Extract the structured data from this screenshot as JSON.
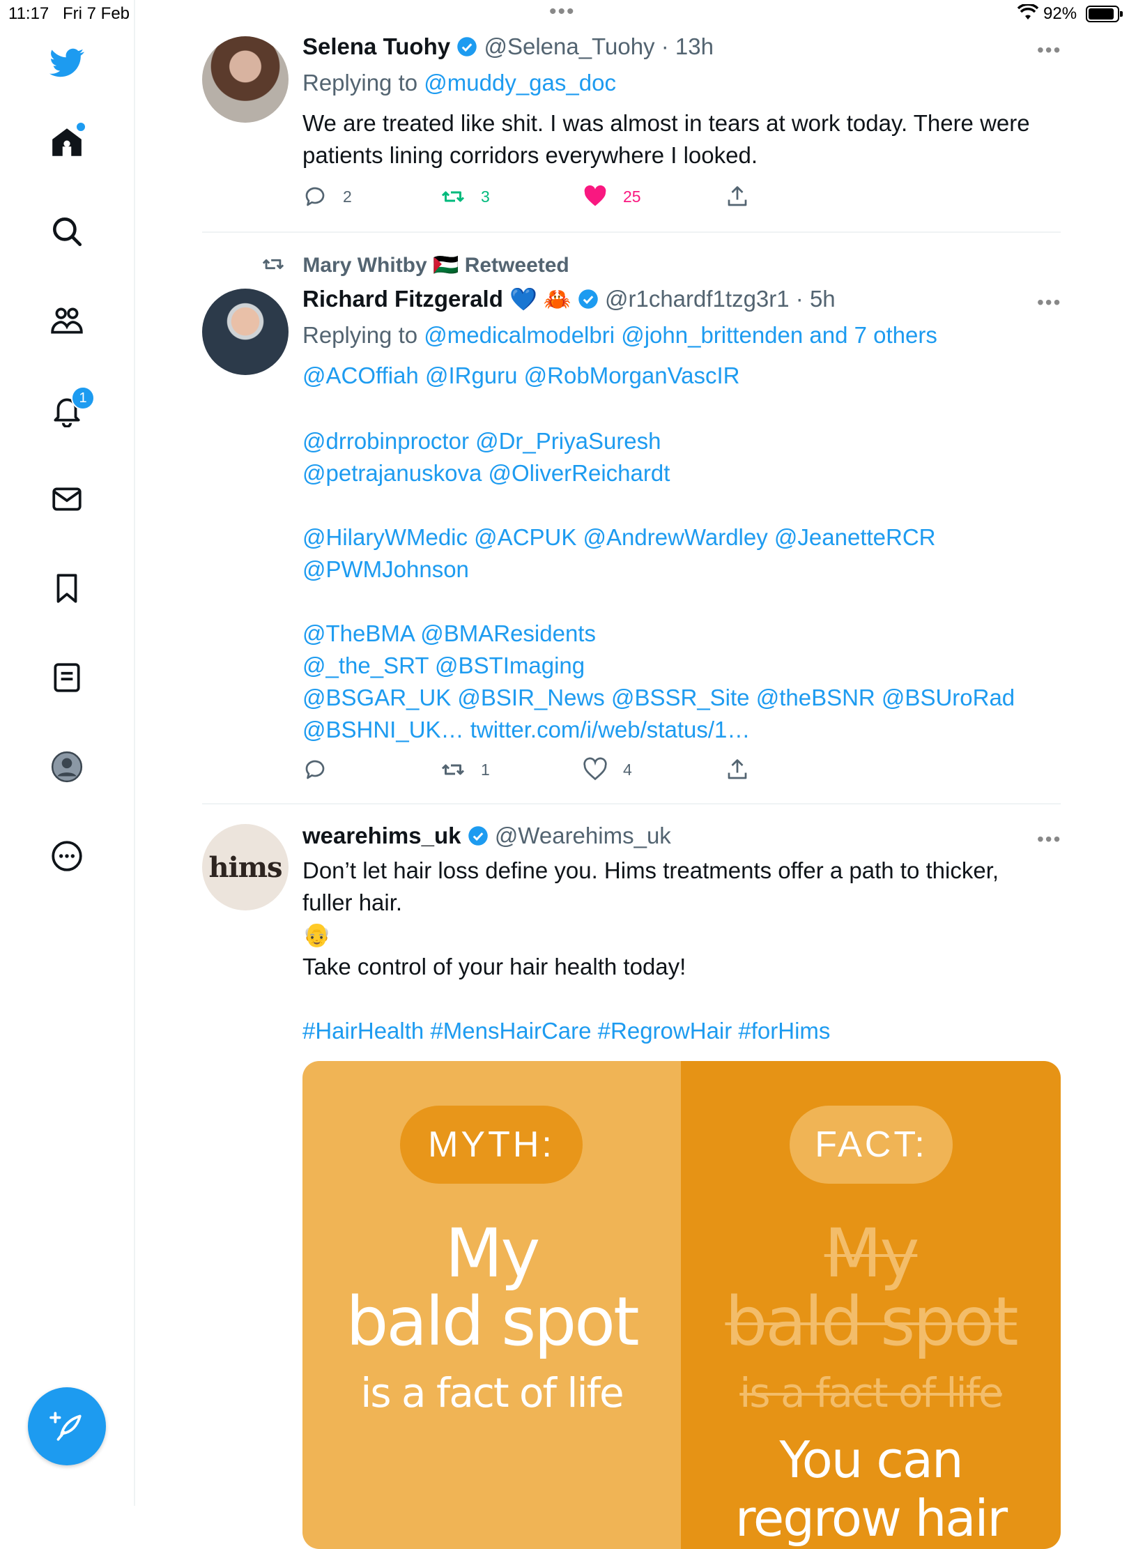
{
  "status_bar": {
    "time": "11:17",
    "date": "Fri 7 Feb",
    "battery": "92%",
    "battery_level": 0.92
  },
  "sidebar": {
    "items": [
      {
        "name": "home",
        "badge_dot": true
      },
      {
        "name": "explore"
      },
      {
        "name": "communities"
      },
      {
        "name": "notifications",
        "badge": "1"
      },
      {
        "name": "messages"
      },
      {
        "name": "bookmarks"
      },
      {
        "name": "lists"
      },
      {
        "name": "profile"
      },
      {
        "name": "more"
      }
    ],
    "accent": "#1d9bf0"
  },
  "tweets": [
    {
      "name": "Selena Tuohy",
      "handle": "@Selena_Tuohy",
      "time": "· 13h",
      "replying_label": "Replying to",
      "replying_to": "@muddy_gas_doc",
      "text_lines": [
        "We are treated like shit. I was almost in tears at work today. There were",
        "patients lining corridors everywhere I looked."
      ],
      "replies": "2",
      "retweets": "3",
      "likes": "25"
    },
    {
      "retweeted_by": "Mary Whitby 🇵🇸 Retweeted",
      "name": "Richard Fitzgerald",
      "name_emojis": "💙 🦀",
      "handle": "@r1chardf1tzg3r1",
      "time": "· 5h",
      "replying_label": "Replying to",
      "replying_to": "@medicalmodelbri @john_brittenden and 7 others",
      "mention_lines": [
        "@ACOffiah @IRguru @RobMorganVascIR",
        "@drrobinproctor @Dr_PriyaSuresh",
        "@petrajanuskova @OliverReichardt",
        "@HilaryWMedic @ACPUK @AndrewWardley @JeanetteRCR",
        "@PWMJohnson",
        "@TheBMA @BMAResidents",
        "@_the_SRT @BSTImaging",
        "@BSGAR_UK @BSIR_News @BSSR_Site @theBSNR @BSUroRad",
        "@BSHNI_UK… twitter.com/i/web/status/1…"
      ],
      "replies": "",
      "retweets": "1",
      "likes": "4"
    },
    {
      "name": "wearehims_uk",
      "handle": "@Wearehims_uk",
      "avatar_text": "hims",
      "text_lines": [
        "Don’t let hair loss define you. Hims treatments offer a path to thicker,",
        "fuller hair.",
        "👴",
        "Take control of your hair health today!"
      ],
      "hashtags": "#HairHealth #MensHairCare #RegrowHair #forHims",
      "promo": {
        "myth_label": "MYTH:",
        "fact_label": "FACT:",
        "myth_line1": "My",
        "myth_line2": "bald spot",
        "myth_line3": "is a fact of life",
        "fact_line1": "My",
        "fact_line2": "bald spot",
        "fact_line3": "is a fact of life",
        "fact_line4": "You can",
        "fact_line5": "regrow hair"
      }
    }
  ]
}
